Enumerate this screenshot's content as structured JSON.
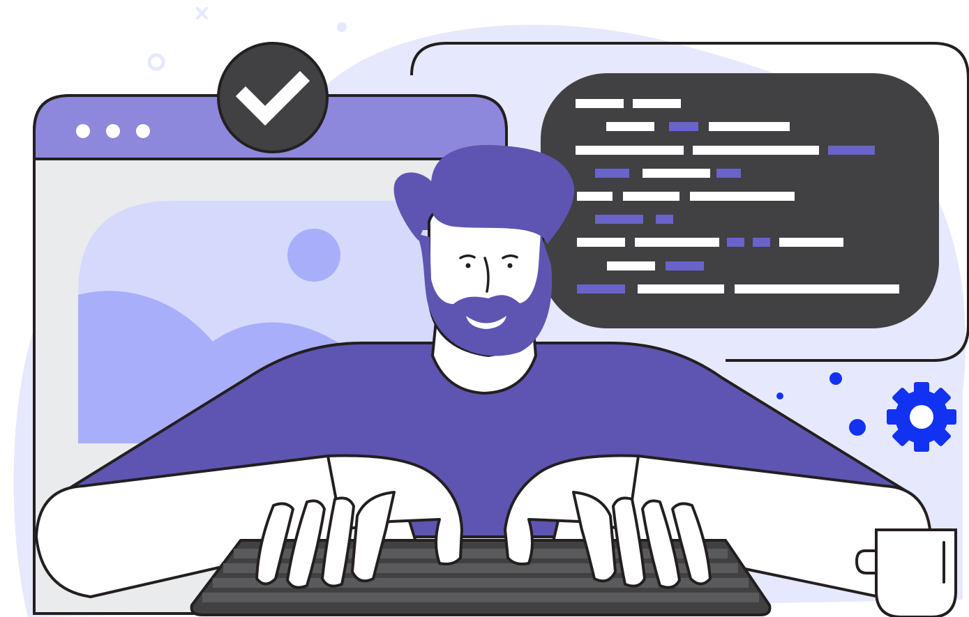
{
  "colors": {
    "blob": "#e6e8fd",
    "window_frame_top": "#8d88dc",
    "window_body": "#e9ebec",
    "landscape_bg": "#d5d9fb",
    "landscape_shapes": "#a8aef9",
    "primary_purple": "#5d55b1",
    "dark": "#414042",
    "outline": "#231f20",
    "white": "#ffffff",
    "accent_blue": "#1232f2",
    "skin": "#ffffff"
  },
  "icons": [
    "window-dots-icon",
    "checkmark-icon",
    "image-placeholder-icon",
    "code-bubble-icon",
    "gear-icon",
    "coffee-mug-icon",
    "keyboard-icon"
  ]
}
